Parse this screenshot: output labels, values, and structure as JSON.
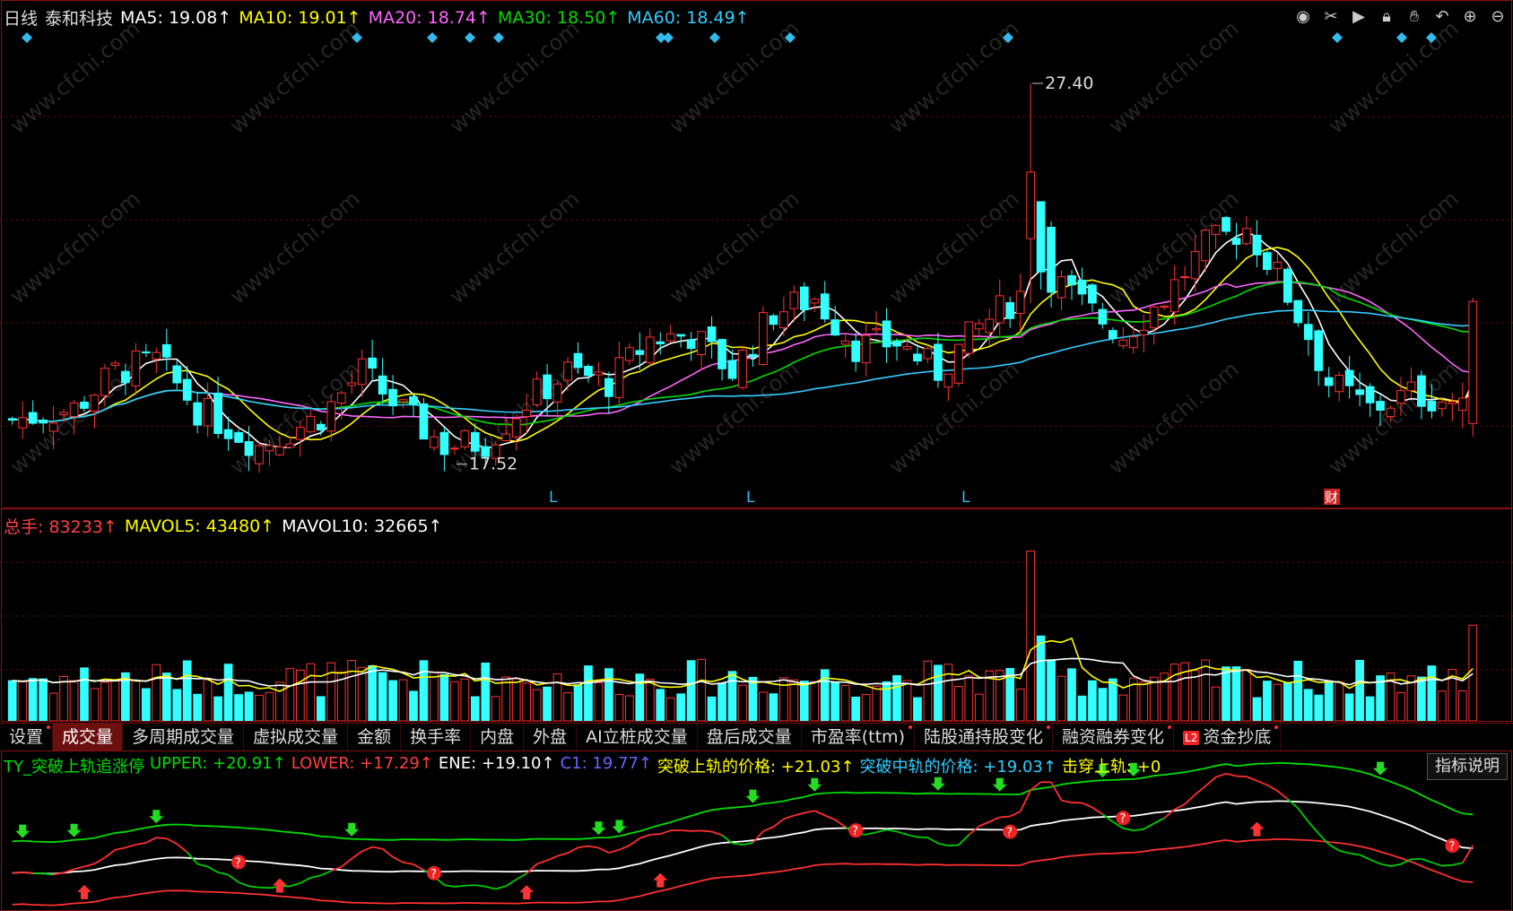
{
  "header": {
    "period": "日线",
    "stock_name": "泰和科技",
    "ma": [
      {
        "label": "MA5: 19.08↑",
        "color": "#ffffff"
      },
      {
        "label": "MA10: 19.01↑",
        "color": "#ffff00"
      },
      {
        "label": "MA20: 18.74↑",
        "color": "#ff66ff"
      },
      {
        "label": "MA30: 18.50↑",
        "color": "#00dd00"
      },
      {
        "label": "MA60: 18.49↑",
        "color": "#33ccff"
      }
    ],
    "toolbar_icons": [
      "eye-icon",
      "scissors-icon",
      "play-icon",
      "lock-icon",
      "hand-icon",
      "undo-icon",
      "zoom-in-icon",
      "zoom-out-icon"
    ]
  },
  "kline": {
    "high_label": "27.40",
    "low_label": "17.52",
    "markers": [
      "L",
      "L",
      "L"
    ],
    "fin_marker": "财",
    "up_color": "#ff3333",
    "down_color": "#33ffff",
    "watermark": "www.cfchi.com"
  },
  "volume": {
    "legend": [
      {
        "label": "总手: 83233↑",
        "color": "#ff4040"
      },
      {
        "label": "MAVOL5: 43480↑",
        "color": "#ffff00"
      },
      {
        "label": "MAVOL10: 32665↑",
        "color": "#ffffff"
      }
    ]
  },
  "tabs": [
    {
      "label": "设置",
      "active": false,
      "dot": true
    },
    {
      "label": "成交量",
      "active": true,
      "dot": false
    },
    {
      "label": "多周期成交量",
      "active": false,
      "dot": false
    },
    {
      "label": "虚拟成交量",
      "active": false,
      "dot": false
    },
    {
      "label": "金额",
      "active": false,
      "dot": false
    },
    {
      "label": "换手率",
      "active": false,
      "dot": false
    },
    {
      "label": "内盘",
      "active": false,
      "dot": false
    },
    {
      "label": "外盘",
      "active": false,
      "dot": false
    },
    {
      "label": "AI立桩成交量",
      "active": false,
      "dot": false
    },
    {
      "label": "盘后成交量",
      "active": false,
      "dot": false
    },
    {
      "label": "市盈率(ttm)",
      "active": false,
      "dot": true
    },
    {
      "label": "陆股通持股变化",
      "active": false,
      "dot": true
    },
    {
      "label": "融资融券变化",
      "active": false,
      "dot": true
    },
    {
      "label": "资金抄底",
      "active": false,
      "dot": true,
      "badge": "L2"
    }
  ],
  "indicator": {
    "legend": [
      {
        "label": "TY_突破上轨追涨停",
        "color": "#00dd00"
      },
      {
        "label": "UPPER: +20.91↑",
        "color": "#00dd00"
      },
      {
        "label": "LOWER: +17.29↑",
        "color": "#ff4040"
      },
      {
        "label": "ENE: +19.10↑",
        "color": "#ffffff"
      },
      {
        "label": "C1: 19.77↑",
        "color": "#6666ff"
      },
      {
        "label": "突破上轨的价格: +21.03↑",
        "color": "#ffff00"
      },
      {
        "label": "突破中轨的价格: +19.03↑",
        "color": "#33ccff"
      },
      {
        "label": "击穿上轨: +0",
        "color": "#ffff00"
      }
    ],
    "help_button": "指标说明"
  }
}
